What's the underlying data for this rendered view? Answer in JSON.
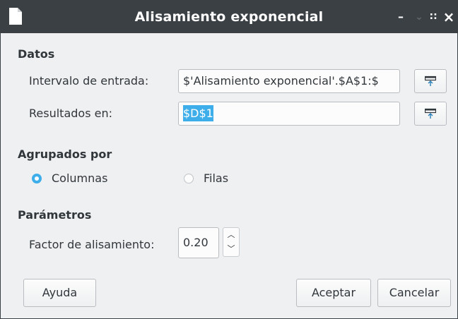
{
  "window": {
    "title": "Alisamiento exponencial",
    "controls": {
      "minimize": "–",
      "maximize": "∷",
      "close": "×"
    }
  },
  "datos": {
    "heading": "Datos",
    "input_range_label": "Intervalo de entrada:",
    "input_range_value": "$'Alisamiento exponencial'.$A$1:$",
    "results_label": "Resultados en:",
    "results_value": "$D$1"
  },
  "grouped": {
    "heading": "Agrupados por",
    "options": [
      "Columnas",
      "Filas"
    ],
    "selected": "Columnas"
  },
  "params": {
    "heading": "Parámetros",
    "smoothing_label": "Factor de alisamiento:",
    "smoothing_value": "0.20"
  },
  "buttons": {
    "help": "Ayuda",
    "ok": "Aceptar",
    "cancel": "Cancelar"
  },
  "icons": {
    "app": "document-icon",
    "shrink": "shrink-dialog-icon",
    "spin_up": "chevron-up-icon",
    "spin_down": "chevron-down-icon"
  },
  "colors": {
    "titlebar": "#3b4045",
    "accent": "#3daee9",
    "background": "#eff0f1"
  }
}
